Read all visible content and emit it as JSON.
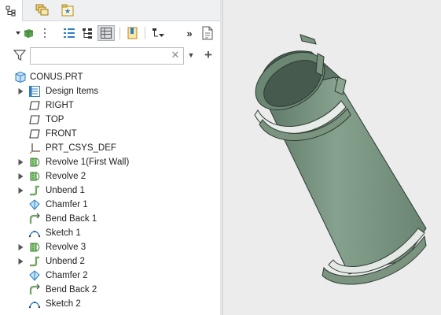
{
  "filter": {
    "search_value": "",
    "clear_glyph": "✕"
  },
  "tree": {
    "root": {
      "label": "CONUS.PRT",
      "icon": "part-icon"
    },
    "items": [
      {
        "label": "Design Items",
        "icon": "design-items-icon",
        "expandable": true
      },
      {
        "label": "RIGHT",
        "icon": "datum-plane-icon",
        "expandable": false
      },
      {
        "label": "TOP",
        "icon": "datum-plane-icon",
        "expandable": false
      },
      {
        "label": "FRONT",
        "icon": "datum-plane-icon",
        "expandable": false
      },
      {
        "label": "PRT_CSYS_DEF",
        "icon": "csys-icon",
        "expandable": false
      },
      {
        "label": "Revolve 1(First Wall)",
        "icon": "revolve-icon",
        "expandable": true
      },
      {
        "label": "Revolve 2",
        "icon": "revolve-icon",
        "expandable": true
      },
      {
        "label": "Unbend 1",
        "icon": "unbend-icon",
        "expandable": true
      },
      {
        "label": "Chamfer 1",
        "icon": "chamfer-icon",
        "expandable": false
      },
      {
        "label": "Bend Back 1",
        "icon": "bend-back-icon",
        "expandable": false
      },
      {
        "label": "Sketch 1",
        "icon": "sketch-icon",
        "expandable": false
      },
      {
        "label": "Revolve 3",
        "icon": "revolve-icon",
        "expandable": true
      },
      {
        "label": "Unbend 2",
        "icon": "unbend-icon",
        "expandable": true
      },
      {
        "label": "Chamfer 2",
        "icon": "chamfer-icon",
        "expandable": false
      },
      {
        "label": "Bend Back 2",
        "icon": "bend-back-icon",
        "expandable": false
      },
      {
        "label": "Sketch 2",
        "icon": "sketch-icon",
        "expandable": false
      }
    ]
  },
  "colors": {
    "model_fill": "#6f8877",
    "model_edge": "#2f3b33",
    "graphics_bg": "#ececec",
    "accent_blue": "#2f7fc4"
  }
}
